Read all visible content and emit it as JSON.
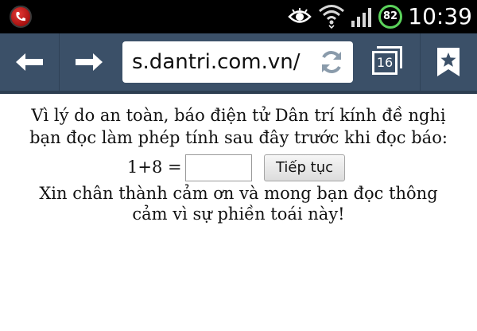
{
  "status_bar": {
    "battery_level": "82",
    "time": "10:39"
  },
  "browser": {
    "url": "s.dantri.com.vn/",
    "tab_count": "16"
  },
  "page": {
    "message_line1": "Vì lý do an toàn, báo điện tử Dân trí kính đề nghị",
    "message_line2": "bạn đọc làm phép tính sau đây trước khi đọc báo:",
    "captcha_question": "1+8 =",
    "answer_value": "",
    "submit_label": "Tiếp tục",
    "thanks_line1": "Xin chân thành cảm ơn và mong bạn đọc thông",
    "thanks_line2": "cảm vì sự phiền toái này!"
  },
  "colors": {
    "toolbar": "#3b5068",
    "status_bar": "#000000",
    "battery_ring": "#5bd35b"
  }
}
